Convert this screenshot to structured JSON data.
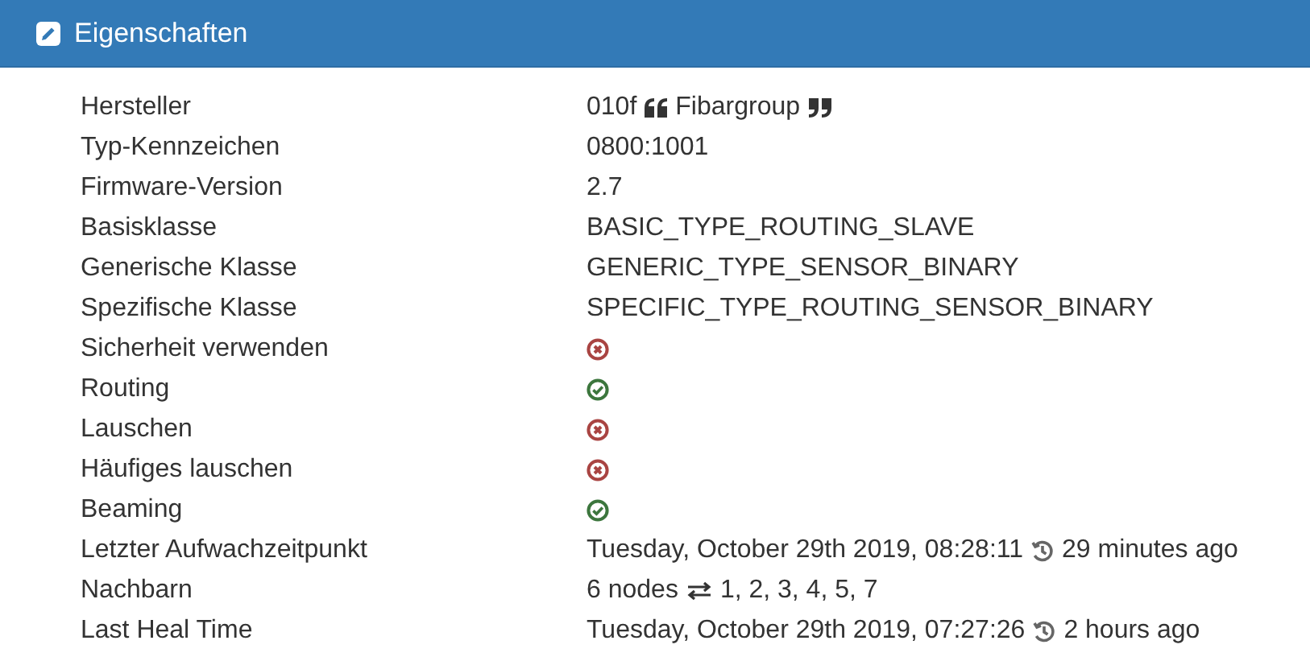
{
  "panel": {
    "title": "Eigenschaften"
  },
  "rows": [
    {
      "label": "Hersteller",
      "kind": "vendor",
      "id": "010f",
      "name": "Fibargroup"
    },
    {
      "label": "Typ-Kennzeichen",
      "kind": "text",
      "value": "0800:1001"
    },
    {
      "label": "Firmware-Version",
      "kind": "text",
      "value": "2.7"
    },
    {
      "label": "Basisklasse",
      "kind": "text",
      "value": "BASIC_TYPE_ROUTING_SLAVE"
    },
    {
      "label": "Generische Klasse",
      "kind": "text",
      "value": "GENERIC_TYPE_SENSOR_BINARY"
    },
    {
      "label": "Spezifische Klasse",
      "kind": "text",
      "value": "SPECIFIC_TYPE_ROUTING_SENSOR_BINARY"
    },
    {
      "label": "Sicherheit verwenden",
      "kind": "bool",
      "on": false
    },
    {
      "label": "Routing",
      "kind": "bool",
      "on": true
    },
    {
      "label": "Lauschen",
      "kind": "bool",
      "on": false
    },
    {
      "label": "Häufiges lauschen",
      "kind": "bool",
      "on": false
    },
    {
      "label": "Beaming",
      "kind": "bool",
      "on": true
    },
    {
      "label": "Letzter Aufwachzeitpunkt",
      "kind": "timeago",
      "date": "Tuesday, October 29th 2019, 08:28:11",
      "ago": "29 minutes ago"
    },
    {
      "label": "Nachbarn",
      "kind": "neighbors",
      "count": "6 nodes",
      "list": "1, 2, 3, 4, 5, 7"
    },
    {
      "label": "Last Heal Time",
      "kind": "timeago",
      "date": "Tuesday, October 29th 2019, 07:27:26",
      "ago": "2 hours ago"
    }
  ]
}
